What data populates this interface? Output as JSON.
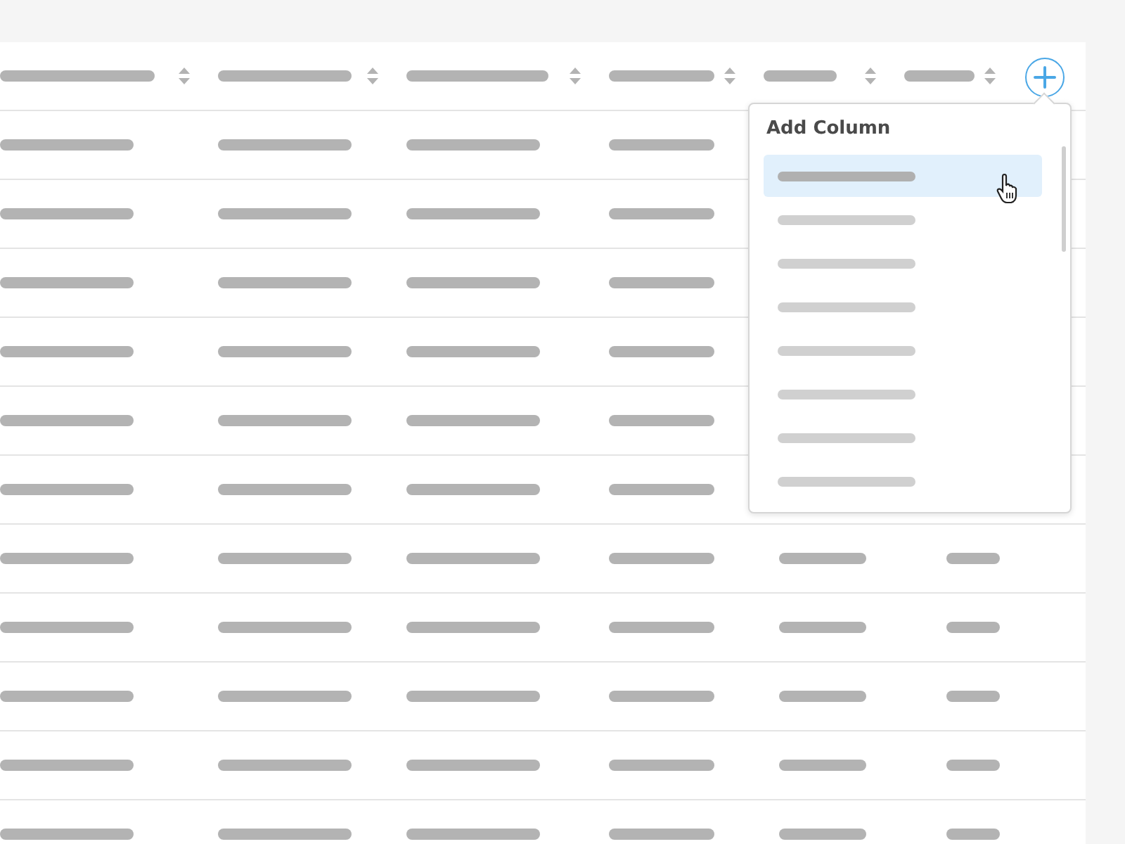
{
  "table": {
    "columns": [
      {
        "sortable": true
      },
      {
        "sortable": true
      },
      {
        "sortable": true
      },
      {
        "sortable": true
      },
      {
        "sortable": true
      },
      {
        "sortable": true
      }
    ]
  },
  "add_column_menu": {
    "title": "Add Column",
    "items": [
      {
        "selected": true
      },
      {
        "selected": false
      },
      {
        "selected": false
      },
      {
        "selected": false
      },
      {
        "selected": false
      },
      {
        "selected": false
      },
      {
        "selected": false
      },
      {
        "selected": false
      }
    ]
  }
}
